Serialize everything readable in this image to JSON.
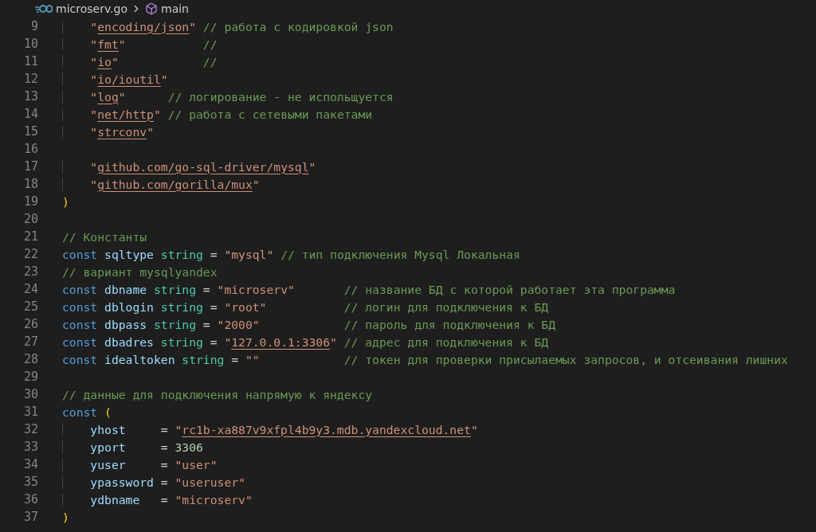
{
  "breadcrumb": {
    "file": "microserv.go",
    "symbol": "main"
  },
  "lines": [
    {
      "number": "9",
      "tokens": [
        {
          "kind": "str",
          "text": "    \""
        },
        {
          "kind": "link",
          "text": "encoding/json"
        },
        {
          "kind": "str",
          "text": "\""
        },
        {
          "kind": "comment",
          "text": " // работа с кодировкой json"
        }
      ]
    },
    {
      "number": "10",
      "tokens": [
        {
          "kind": "str",
          "text": "    \""
        },
        {
          "kind": "link",
          "text": "fmt"
        },
        {
          "kind": "str",
          "text": "\""
        },
        {
          "kind": "comment",
          "text": "           //"
        }
      ]
    },
    {
      "number": "11",
      "tokens": [
        {
          "kind": "str",
          "text": "    \""
        },
        {
          "kind": "link",
          "text": "io"
        },
        {
          "kind": "str",
          "text": "\""
        },
        {
          "kind": "comment",
          "text": "            //"
        }
      ]
    },
    {
      "number": "12",
      "tokens": [
        {
          "kind": "str",
          "text": "    \""
        },
        {
          "kind": "link",
          "text": "io/ioutil"
        },
        {
          "kind": "str",
          "text": "\""
        }
      ]
    },
    {
      "number": "13",
      "tokens": [
        {
          "kind": "str",
          "text": "    \""
        },
        {
          "kind": "link",
          "text": "log"
        },
        {
          "kind": "str",
          "text": "\""
        },
        {
          "kind": "comment",
          "text": "      // логирование - не испольщуется"
        }
      ]
    },
    {
      "number": "14",
      "tokens": [
        {
          "kind": "str",
          "text": "    \""
        },
        {
          "kind": "link",
          "text": "net/http"
        },
        {
          "kind": "str",
          "text": "\""
        },
        {
          "kind": "comment",
          "text": " // работа с сетевыми пакетами"
        }
      ]
    },
    {
      "number": "15",
      "tokens": [
        {
          "kind": "str",
          "text": "    \""
        },
        {
          "kind": "link",
          "text": "strconv"
        },
        {
          "kind": "str",
          "text": "\""
        }
      ]
    },
    {
      "number": "16"
    },
    {
      "number": "17",
      "tokens": [
        {
          "kind": "str",
          "text": "    \""
        },
        {
          "kind": "link",
          "text": "github.com/go-sql-driver/mysql"
        },
        {
          "kind": "str",
          "text": "\""
        }
      ]
    },
    {
      "number": "18",
      "tokens": [
        {
          "kind": "str",
          "text": "    \""
        },
        {
          "kind": "link",
          "text": "github.com/gorilla/mux"
        },
        {
          "kind": "str",
          "text": "\""
        }
      ]
    },
    {
      "number": "19",
      "tokens": [
        {
          "kind": "paren",
          "text": ")"
        }
      ]
    },
    {
      "number": "20"
    },
    {
      "number": "21",
      "tokens": [
        {
          "kind": "comment",
          "text": "// Константы"
        }
      ]
    },
    {
      "number": "22",
      "tokens": [
        {
          "kind": "kw",
          "text": "const "
        },
        {
          "kind": "ident",
          "text": "sqltype "
        },
        {
          "kind": "type",
          "text": "string"
        },
        {
          "kind": "op",
          "text": " = "
        },
        {
          "kind": "str",
          "text": "\"mysql\""
        },
        {
          "kind": "comment",
          "text": " // тип подключения Mysql Локальная"
        }
      ]
    },
    {
      "number": "23",
      "tokens": [
        {
          "kind": "comment",
          "text": "// вариант mysqlyandex"
        }
      ]
    },
    {
      "number": "24",
      "tokens": [
        {
          "kind": "kw",
          "text": "const "
        },
        {
          "kind": "ident",
          "text": "dbname "
        },
        {
          "kind": "type",
          "text": "string"
        },
        {
          "kind": "op",
          "text": " = "
        },
        {
          "kind": "str",
          "text": "\"microserv\""
        },
        {
          "kind": "comment",
          "text": "       // название БД с которой работает эта программа"
        }
      ]
    },
    {
      "number": "25",
      "tokens": [
        {
          "kind": "kw",
          "text": "const "
        },
        {
          "kind": "ident",
          "text": "dblogin "
        },
        {
          "kind": "type",
          "text": "string"
        },
        {
          "kind": "op",
          "text": " = "
        },
        {
          "kind": "str",
          "text": "\"root\""
        },
        {
          "kind": "comment",
          "text": "           // логин для подключения к БД"
        }
      ]
    },
    {
      "number": "26",
      "tokens": [
        {
          "kind": "kw",
          "text": "const "
        },
        {
          "kind": "ident",
          "text": "dbpass "
        },
        {
          "kind": "type",
          "text": "string"
        },
        {
          "kind": "op",
          "text": " = "
        },
        {
          "kind": "str",
          "text": "\"2000\""
        },
        {
          "kind": "comment",
          "text": "            // пароль для подключения к БД"
        }
      ]
    },
    {
      "number": "27",
      "tokens": [
        {
          "kind": "kw",
          "text": "const "
        },
        {
          "kind": "ident",
          "text": "dbadres "
        },
        {
          "kind": "type",
          "text": "string"
        },
        {
          "kind": "op",
          "text": " = "
        },
        {
          "kind": "str",
          "text": "\""
        },
        {
          "kind": "link",
          "text": "127.0.0.1:3306"
        },
        {
          "kind": "str",
          "text": "\""
        },
        {
          "kind": "comment",
          "text": " // адрес для подключения к БД"
        }
      ]
    },
    {
      "number": "28",
      "tokens": [
        {
          "kind": "kw",
          "text": "const "
        },
        {
          "kind": "ident",
          "text": "idealtoken "
        },
        {
          "kind": "type",
          "text": "string"
        },
        {
          "kind": "op",
          "text": " = "
        },
        {
          "kind": "str",
          "text": "\"\""
        },
        {
          "kind": "comment",
          "text": "            // токен для проверки присылаемых запросов, и отсеивания лишних"
        }
      ]
    },
    {
      "number": "29"
    },
    {
      "number": "30",
      "tokens": [
        {
          "kind": "comment",
          "text": "// данные для подключения напрямую к яндексу"
        }
      ]
    },
    {
      "number": "31",
      "tokens": [
        {
          "kind": "kw",
          "text": "const "
        },
        {
          "kind": "paren",
          "text": "("
        }
      ]
    },
    {
      "number": "32",
      "tokens": [
        {
          "kind": "ident",
          "text": "    yhost     "
        },
        {
          "kind": "op",
          "text": "= "
        },
        {
          "kind": "str",
          "text": "\""
        },
        {
          "kind": "link",
          "text": "rc1b-xa887v9xfpl4b9y3.mdb.yandexcloud.net"
        },
        {
          "kind": "str",
          "text": "\""
        }
      ]
    },
    {
      "number": "33",
      "tokens": [
        {
          "kind": "ident",
          "text": "    yport     "
        },
        {
          "kind": "op",
          "text": "= "
        },
        {
          "kind": "num",
          "text": "3306"
        }
      ]
    },
    {
      "number": "34",
      "tokens": [
        {
          "kind": "ident",
          "text": "    yuser     "
        },
        {
          "kind": "op",
          "text": "= "
        },
        {
          "kind": "str",
          "text": "\"user\""
        }
      ]
    },
    {
      "number": "35",
      "tokens": [
        {
          "kind": "ident",
          "text": "    ypassword "
        },
        {
          "kind": "op",
          "text": "= "
        },
        {
          "kind": "str",
          "text": "\"useruser\""
        }
      ]
    },
    {
      "number": "36",
      "tokens": [
        {
          "kind": "ident",
          "text": "    ydbname   "
        },
        {
          "kind": "op",
          "text": "= "
        },
        {
          "kind": "str",
          "text": "\"microserv\""
        }
      ]
    },
    {
      "number": "37",
      "tokens": [
        {
          "kind": "paren",
          "text": ")"
        }
      ]
    }
  ]
}
